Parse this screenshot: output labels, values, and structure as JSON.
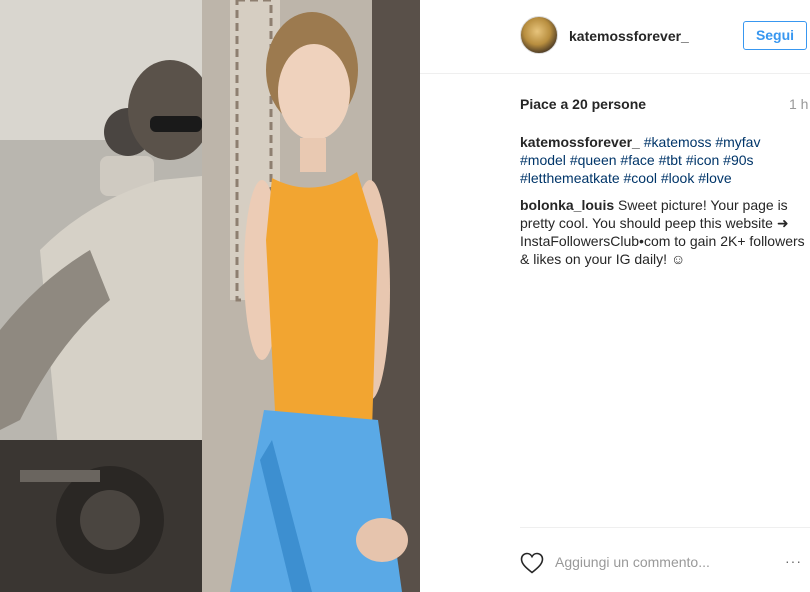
{
  "post": {
    "photo_alt": "Kate Moss photo"
  },
  "header": {
    "username": "katemossforever_",
    "follow_label": "Segui"
  },
  "meta": {
    "likes": "Piace a 20 persone",
    "time": "1 h"
  },
  "caption": {
    "user": "katemossforever_",
    "hashtags": [
      "#katemoss",
      "#myfav",
      "#model",
      "#queen",
      "#face",
      "#tbt",
      "#icon",
      "#90s",
      "#letthemeatkate",
      "#cool",
      "#look",
      "#love"
    ]
  },
  "comment": {
    "user": "bolonka_louis",
    "text": "Sweet picture! Your page is pretty cool. You should peep this website ➜ InstaFollowersClub•com to gain 2K+ followers & likes on your IG daily! ☺"
  },
  "footer": {
    "add_comment_placeholder": "Aggiungi un commento...",
    "more": "···",
    "like_icon": "heart-icon"
  },
  "colors": {
    "accent": "#3897f0",
    "hashtag": "#003569",
    "shirt": "#f2a531",
    "jeans": "#5aa9e6"
  }
}
